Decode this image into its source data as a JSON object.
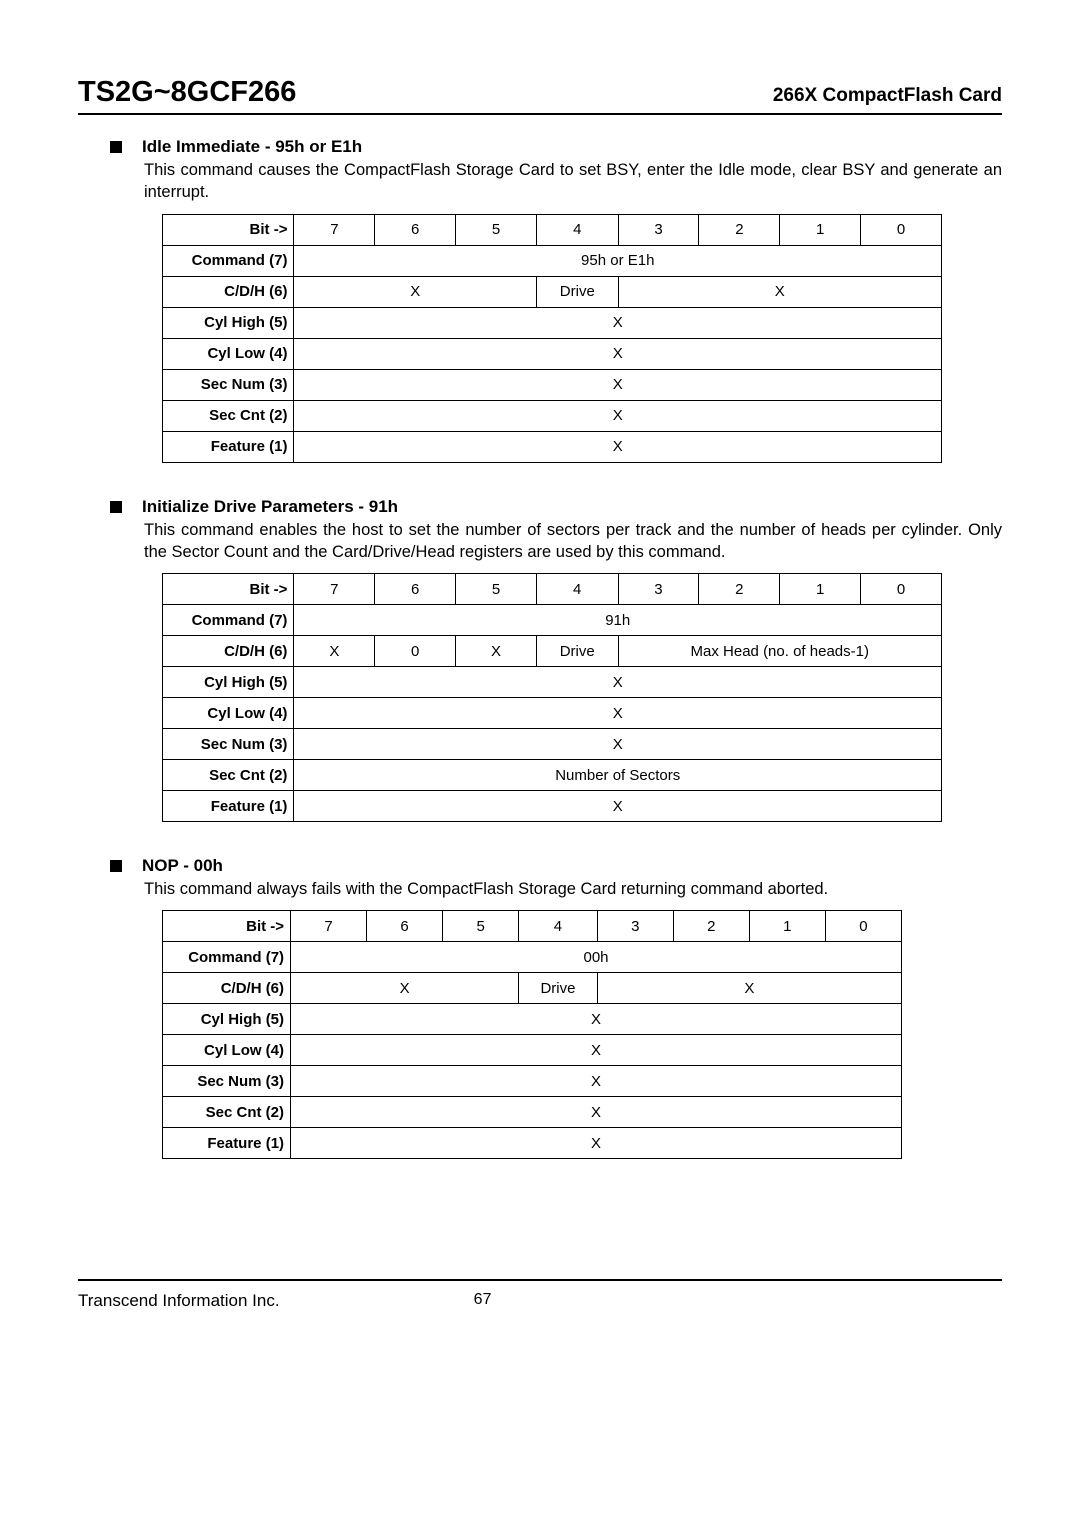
{
  "header": {
    "product": "TS2G~8GCF266",
    "subtitle": "266X CompactFlash Card"
  },
  "sections": [
    {
      "title": "Idle Immediate - 95h or E1h",
      "body": "This command causes the CompactFlash Storage Card to set BSY, enter the Idle mode, clear BSY and generate an interrupt."
    },
    {
      "title": "Initialize Drive Parameters - 91h",
      "body": "This command enables the host to set the number of sectors per track and the number of heads per cylinder. Only the Sector Count and the Card/Drive/Head registers are used by this command."
    },
    {
      "title": "NOP - 00h",
      "body": "This command always fails with the CompactFlash Storage Card returning command aborted."
    }
  ],
  "table_common": {
    "bit_label": "Bit ->",
    "bits": [
      "7",
      "6",
      "5",
      "4",
      "3",
      "2",
      "1",
      "0"
    ],
    "row_labels": [
      "Command (7)",
      "C/D/H (6)",
      "Cyl High (5)",
      "Cyl Low (4)",
      "Sec Num (3)",
      "Sec Cnt (2)",
      "Feature (1)"
    ]
  },
  "table1": {
    "command_value": "95h or E1h",
    "cdh": {
      "left": "X",
      "drive": "Drive",
      "right": "X"
    },
    "cyl_high": "X",
    "cyl_low": "X",
    "sec_num": "X",
    "sec_cnt": "X",
    "feature": "X"
  },
  "table2": {
    "command_value": "91h",
    "cdh": {
      "c7": "X",
      "c6": "0",
      "c5": "X",
      "drive": "Drive",
      "right": "Max Head (no. of heads-1)"
    },
    "cyl_high": "X",
    "cyl_low": "X",
    "sec_num": "X",
    "sec_cnt": "Number of Sectors",
    "feature": "X"
  },
  "table3": {
    "command_value": "00h",
    "cdh": {
      "left": "X",
      "drive": "Drive",
      "right": "X"
    },
    "cyl_high": "X",
    "cyl_low": "X",
    "sec_num": "X",
    "sec_cnt": "X",
    "feature": "X"
  },
  "footer": {
    "company": "Transcend Information Inc.",
    "page": "67"
  }
}
